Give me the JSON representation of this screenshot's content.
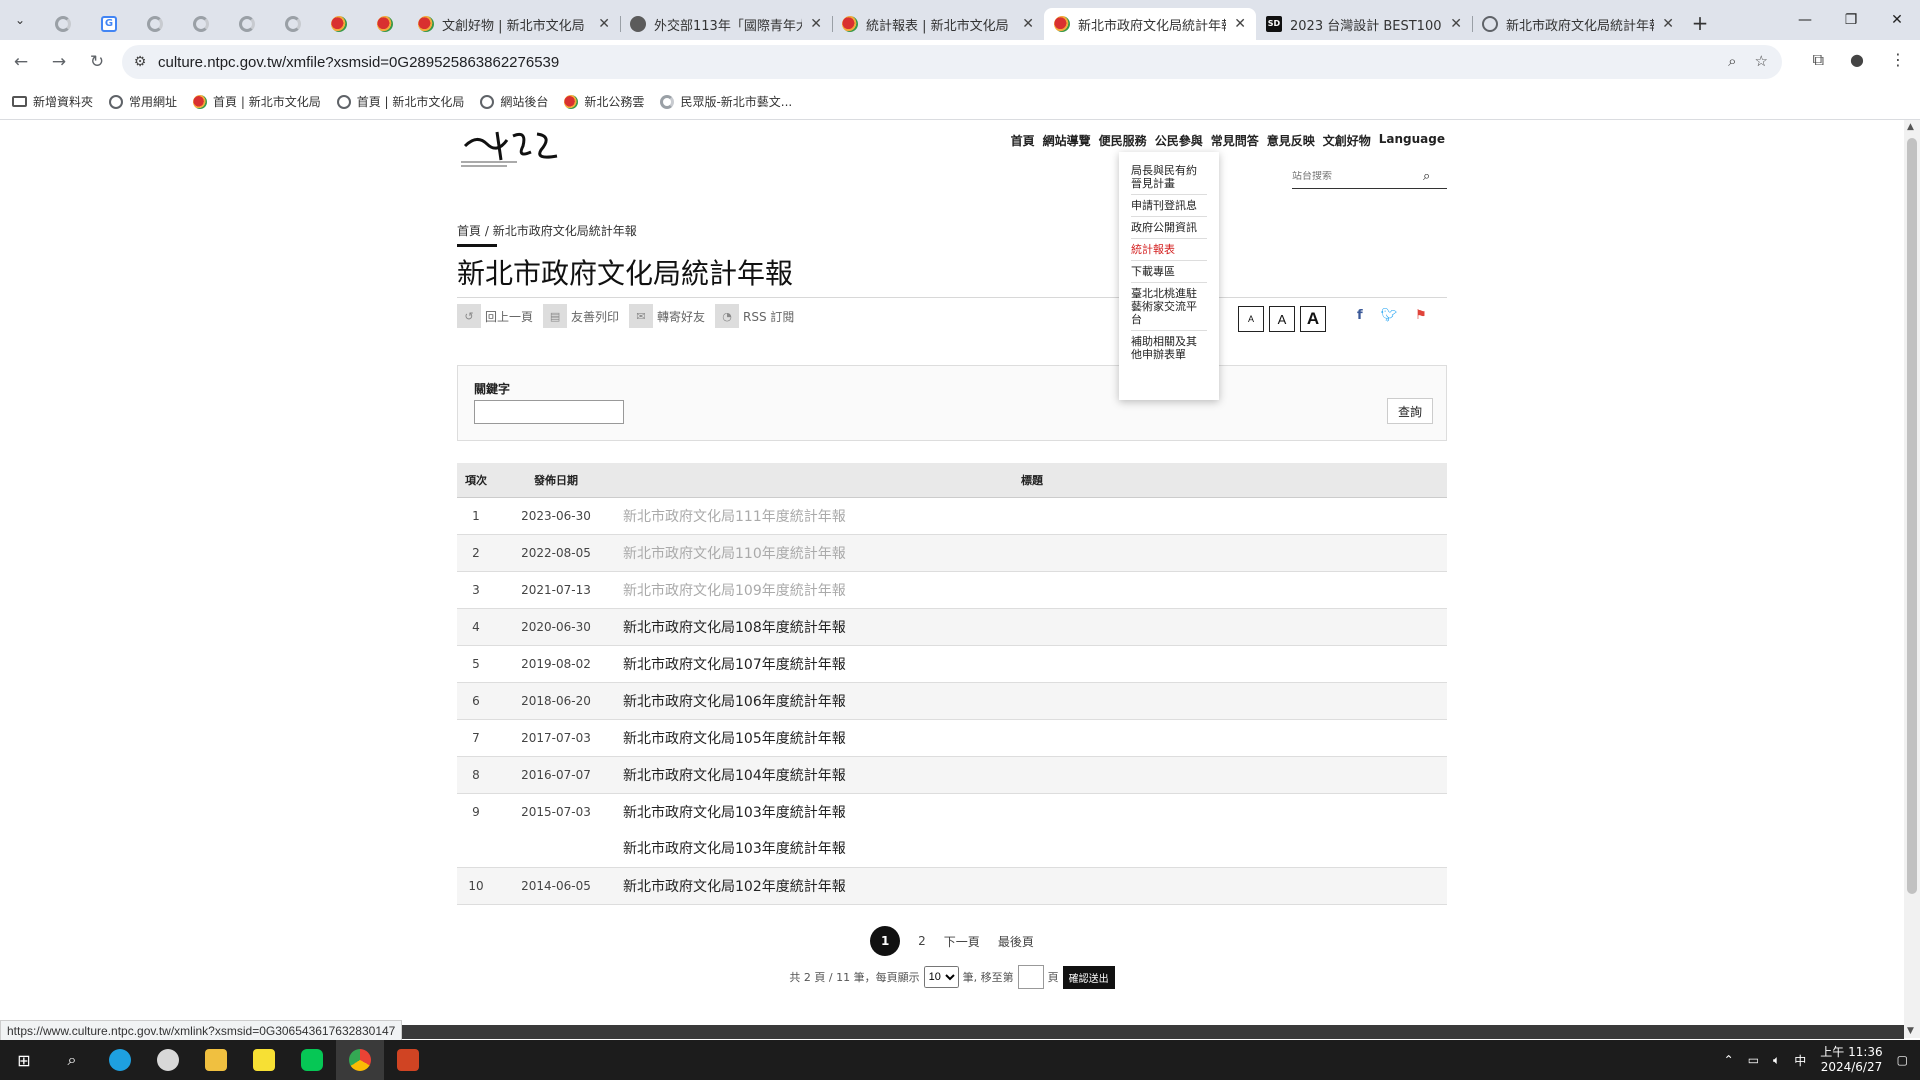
{
  "browser": {
    "tabs": [
      {
        "title": "文創好物 | 新北市文化局",
        "favicon": "ntpc-icon"
      },
      {
        "title": "外交部113年「國際青年大",
        "favicon": "mofa-icon"
      },
      {
        "title": "統計報表 | 新北市文化局",
        "favicon": "ntpc-icon"
      },
      {
        "title": "新北市政府文化局統計年報",
        "favicon": "ntpc-icon",
        "active": true
      },
      {
        "title": "2023 台灣設計 BEST100 &",
        "favicon": "sd-icon"
      },
      {
        "title": "新北市政府文化局統計年報",
        "favicon": "globe-icon"
      }
    ],
    "sd_label": "SD",
    "url": "culture.ntpc.gov.tw/xmfile?xsmsid=0G289525863862276539",
    "bookmarks": [
      "新增資料夾",
      "常用網址",
      "首頁 | 新北市文化局",
      "首頁 | 新北市文化局",
      "網站後台",
      "新北公務雲",
      "民眾版-新北市藝文..."
    ],
    "status_url": "https://www.culture.ntpc.gov.tw/xmlink?xsmsid=0G306543617632830147"
  },
  "site": {
    "nav": [
      "首頁",
      "網站導覽",
      "便民服務",
      "公民參與",
      "常見問答",
      "意見反映",
      "文創好物",
      "Language"
    ],
    "dropdown": [
      "局長與民有約晉見計畫",
      "申請刊登訊息",
      "政府公開資訊",
      "統計報表",
      "下載專區",
      "臺北北桃進駐藝術家交流平台",
      "補助相關及其他申辦表單"
    ],
    "search_placeholder": "站台搜索",
    "breadcrumb": {
      "home": "首頁",
      "sep": "/",
      "current": "新北市政府文化局統計年報"
    },
    "page_title": "新北市政府文化局統計年報",
    "tools": [
      "回上一頁",
      "友善列印",
      "轉寄好友",
      "RSS 訂閱"
    ],
    "font_sizes": [
      "A",
      "A",
      "A"
    ],
    "filter": {
      "label": "關鍵字",
      "button": "查詢"
    },
    "table": {
      "headers": [
        "項次",
        "發佈日期",
        "標題"
      ],
      "rows": [
        {
          "no": "1",
          "date": "2023-06-30",
          "title": "新北市政府文化局111年度統計年報",
          "visited": true
        },
        {
          "no": "2",
          "date": "2022-08-05",
          "title": "新北市政府文化局110年度統計年報",
          "visited": true
        },
        {
          "no": "3",
          "date": "2021-07-13",
          "title": "新北市政府文化局109年度統計年報",
          "visited": true
        },
        {
          "no": "4",
          "date": "2020-06-30",
          "title": "新北市政府文化局108年度統計年報"
        },
        {
          "no": "5",
          "date": "2019-08-02",
          "title": "新北市政府文化局107年度統計年報"
        },
        {
          "no": "6",
          "date": "2018-06-20",
          "title": "新北市政府文化局106年度統計年報"
        },
        {
          "no": "7",
          "date": "2017-07-03",
          "title": "新北市政府文化局105年度統計年報"
        },
        {
          "no": "8",
          "date": "2016-07-07",
          "title": "新北市政府文化局104年度統計年報"
        },
        {
          "no": "9",
          "date": "2015-07-03",
          "title": "新北市政府文化局103年度統計年報"
        },
        {
          "no": "",
          "date": "",
          "title": "新北市政府文化局103年度統計年報"
        },
        {
          "no": "10",
          "date": "2014-06-05",
          "title": "新北市政府文化局102年度統計年報"
        }
      ]
    },
    "pager": {
      "current": "1",
      "page2": "2",
      "next": "下一頁",
      "last": "最後頁",
      "summary_pre": "共 2 頁 / 11 筆，每頁顯示",
      "per_page": "10",
      "summary_mid": "筆, 移至第",
      "summary_post": "頁",
      "go": "確認送出"
    }
  },
  "taskbar": {
    "time": "上午 11:36",
    "date": "2024/6/27",
    "ime": "中"
  },
  "colors": {
    "accent_red": "#d42020",
    "dark": "#111111"
  }
}
